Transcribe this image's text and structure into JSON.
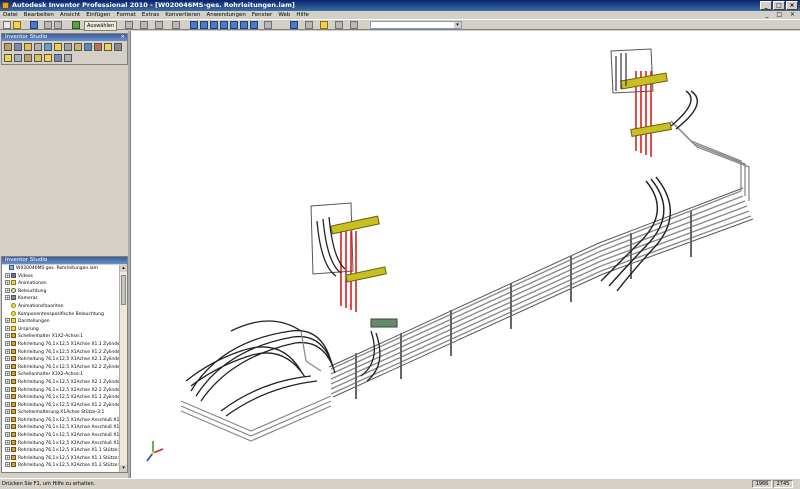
{
  "window": {
    "title": "Autodesk Inventor Professional 2010 - [W020046MS-ges. Rohrleitungen.iam]"
  },
  "menu": [
    "Datei",
    "Bearbeiten",
    "Ansicht",
    "Einfügen",
    "Format",
    "Extras",
    "Konvertieren",
    "Anwendungen",
    "Fenster",
    "Web",
    "Hilfe"
  ],
  "toolbar": {
    "select_label": "Auswählen"
  },
  "panels": {
    "top_title": "Inventor Studio",
    "bottom_title": "Inventor Studio"
  },
  "tree": [
    {
      "icon": "assy",
      "label": "W020046MS ges. Rohrleitungen.iam",
      "exp": ""
    },
    {
      "icon": "video",
      "label": "Videos",
      "exp": "+"
    },
    {
      "icon": "folder",
      "label": "Animationen",
      "exp": "+"
    },
    {
      "icon": "light",
      "label": "Beleuchtung",
      "exp": "+"
    },
    {
      "icon": "cam",
      "label": "Kameras",
      "exp": "+"
    },
    {
      "icon": "star",
      "label": "Animationsfavoriten",
      "exp": ""
    },
    {
      "icon": "star",
      "label": "Komponentenspezifische Beleuchtung",
      "exp": ""
    },
    {
      "icon": "folder",
      "label": "Darstellungen",
      "exp": "+"
    },
    {
      "icon": "folder",
      "label": "Ursprung",
      "exp": "+"
    },
    {
      "icon": "pipe",
      "label": "Schellenhalter X1X2-Achse:1",
      "exp": "+"
    },
    {
      "icon": "pipe",
      "label": "Rohrleitung 76,1×12,5 X1Achse X1.1 Zylinder:1",
      "exp": "+"
    },
    {
      "icon": "pipe",
      "label": "Rohrleitung 76,1×12,5 X1Achse X1.2 Zylinder:1",
      "exp": "+"
    },
    {
      "icon": "pipe",
      "label": "Rohrleitung 76,1×12,5 X1Achse X2.1 Zylinder:1",
      "exp": "+"
    },
    {
      "icon": "pipe",
      "label": "Rohrleitung 76,1×12,5 X1Achse X2.2 Zylinder:1",
      "exp": "+"
    },
    {
      "icon": "pipe",
      "label": "Schellenhalter X3X2-Achse:1",
      "exp": "+"
    },
    {
      "icon": "pipe",
      "label": "Rohrleitung 76,1×12,5 X2Achse X2.1 Zylinder:1",
      "exp": "+"
    },
    {
      "icon": "pipe",
      "label": "Rohrleitung 76,1×12,5 X2Achse X2.2 Zylinder:1",
      "exp": "+"
    },
    {
      "icon": "pipe",
      "label": "Rohrleitung 76,1×12,5 X2Achse X1.1 Zylinder:1",
      "exp": "+"
    },
    {
      "icon": "pipe",
      "label": "Rohrleitung 76,1×12,5 X2Achse X1.2 Zylinder:1",
      "exp": "+"
    },
    {
      "icon": "pipe",
      "label": "Schellenhalterung X1Achse Stütze-3:1",
      "exp": "+"
    },
    {
      "icon": "pipe",
      "label": "Rohrleitung 76,1×12,5 X1Achse Anschluß X1.1 Stütz",
      "exp": "+"
    },
    {
      "icon": "pipe",
      "label": "Rohrleitung 76,1×12,5 X1Achse Anschluß X1.2 Stütz",
      "exp": "+"
    },
    {
      "icon": "pipe",
      "label": "Rohrleitung 76,1×12,5 X2Achse Anschluß X1.1 Stütz",
      "exp": "+"
    },
    {
      "icon": "pipe",
      "label": "Rohrleitung 76,1×12,5 X2Achse Anschluß X1.2 Stütz",
      "exp": "+"
    },
    {
      "icon": "pipe",
      "label": "Rohrleitung 76,1×12,5 X1Achse X1.1 Stütze:1",
      "exp": "+"
    },
    {
      "icon": "pipe",
      "label": "Rohrleitung 76,1×12,5 X1Achse X1.1 Stütze:1",
      "exp": "+"
    },
    {
      "icon": "pipe",
      "label": "Rohrleitung 76,1×12,5 X2Achse X1.2 Stütze:1",
      "exp": "+"
    }
  ],
  "status": {
    "text": "Drücken Sie F1, um Hilfe zu erhalten.",
    "val1": "1966",
    "val2": "2745"
  }
}
